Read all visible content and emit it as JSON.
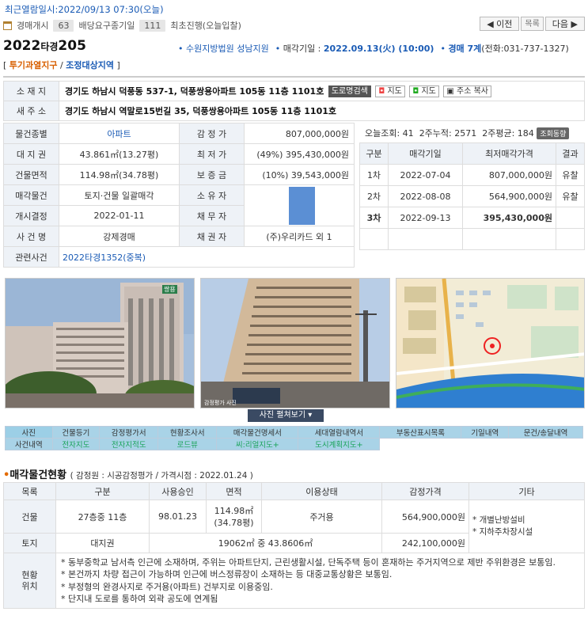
{
  "header": {
    "recent_view": "최근열람일시:2022/09/13 07:30(오늘)",
    "tags": [
      {
        "label": "경매개시",
        "count": "63"
      },
      {
        "label": "배당요구종기일",
        "count": "111"
      },
      {
        "label": "최초진행(오늘입찰)",
        "count": ""
      }
    ],
    "prev_label": "◀ 이전",
    "list_label": "목록",
    "next_label": "다음 ▶",
    "case_year": "2022",
    "case_type": "타경",
    "case_no": "205",
    "court": "수원지방법원 성남지원",
    "auction_date_label": "매각기일 :",
    "auction_date": "2022.09.13(火) (10:00)",
    "dept": "경매 7계",
    "phone": "(전화:031-737-1327)",
    "zone_open": "[",
    "zone1": "투기과열지구",
    "zone_sep": "/",
    "zone2": "조정대상지역",
    "zone_close": "]"
  },
  "address": {
    "lot_label": "소 재 지",
    "lot": "경기도 하남시 덕풍동 537-1, 덕풍쌍용아파트 105동 11층 1101호",
    "road_btn": "도로명검색",
    "map_btn1": "지도",
    "map_btn2": "지도",
    "copy_btn": "주소 복사",
    "road_label": "새 주 소",
    "road": "경기도 하남시 역말로15번길 35, 덕풍쌍용아파트 105동 11층 1101호"
  },
  "info": {
    "rows": [
      {
        "l1": "물건종별",
        "v1": "아파트",
        "l2": "감 정 가",
        "v2": "807,000,000원"
      },
      {
        "l1": "대 지 권",
        "v1": "43.861㎡(13.27평)",
        "l2": "최 저 가",
        "v2": "(49%) 395,430,000원"
      },
      {
        "l1": "건물면적",
        "v1": "114.98㎡(34.78평)",
        "l2": "보 증 금",
        "v2": "(10%) 39,543,000원"
      },
      {
        "l1": "매각물건",
        "v1": "토지·건물 일괄매각",
        "l2": "소 유 자",
        "v2": ""
      },
      {
        "l1": "개시결정",
        "v1": "2022-01-11",
        "l2": "채 무 자",
        "v2": ""
      },
      {
        "l1": "사 건 명",
        "v1": "강제경매",
        "l2": "채 권 자",
        "v2": "(주)우리카드 외 1"
      }
    ],
    "related_label": "관련사건",
    "related": "2022타경1352(중복)"
  },
  "stats": {
    "today": "오늘조회: 41",
    "two_week": "2주누적: 2571",
    "two_week_avg": "2주평균: 184",
    "trend_btn": "조회동향"
  },
  "history": {
    "headers": [
      "구분",
      "매각기일",
      "최저매각가격",
      "결과"
    ],
    "rows": [
      {
        "round": "1차",
        "date": "2022-07-04",
        "price": "807,000,000원",
        "result": "유찰"
      },
      {
        "round": "2차",
        "date": "2022-08-08",
        "price": "564,900,000원",
        "result": "유찰"
      },
      {
        "round": "3차",
        "date": "2022-09-13",
        "price": "395,430,000원",
        "result": ""
      }
    ]
  },
  "photos": {
    "expand_label": "사진 펼쳐보기",
    "photo1_sign": "쌍용",
    "photo2_caption": "감정평가 사진",
    "colors": {
      "sky": "#9fb9d8",
      "building": "#cfc4bd",
      "map_water": "#2f7fd0"
    }
  },
  "tabs": [
    [
      "사진",
      "건물등기",
      "감정평가서",
      "현황조사서",
      "매각물건명세서",
      "세대열람내역서",
      "부동산표시목록",
      "기일내역",
      "문건/송달내역"
    ],
    [
      "사건내역",
      "전자지도",
      "전자지적도",
      "로드뷰",
      "씨:리얼지도+",
      "도시계획지도+"
    ]
  ],
  "section": {
    "title": "매각물건현황",
    "subtitle": "( 감정원 : 시공감정평가 / 가격시점 : 2022.01.24 )",
    "headers": [
      "목록",
      "구분",
      "사용승인",
      "면적",
      "이용상태",
      "감정가격",
      "기타"
    ],
    "building": {
      "type": "건물",
      "desc": "27층중 11층",
      "approved": "98.01.23",
      "area1": "114.98㎡",
      "area2": "(34.78평)",
      "use": "주거용",
      "price": "564,900,000원"
    },
    "land": {
      "type": "토지",
      "desc": "대지권",
      "area": "19062㎡ 중 43.8606㎡",
      "price": "242,100,000원"
    },
    "etc": [
      "* 개별난방설비",
      "* 지하주차장시설"
    ],
    "status_label1": "현황",
    "status_label2": "위치",
    "notes": [
      "* 동부중학교 남서측 인근에 소재하며, 주위는 아파트단지, 근린생활시설, 단독주택 등이 혼재하는 주거지역으로 제반 주위환경은 보통임.",
      "* 본건까지 차량 접근이 가능하며 인근에 버스정류장이 소재하는 등 대중교통상황은 보통임.",
      "* 부정형의 완경사지로 주거용(아파트) 건부지로 이용중임.",
      "* 단지내 도로를 통하여 외곽 공도에 연계됨"
    ]
  }
}
